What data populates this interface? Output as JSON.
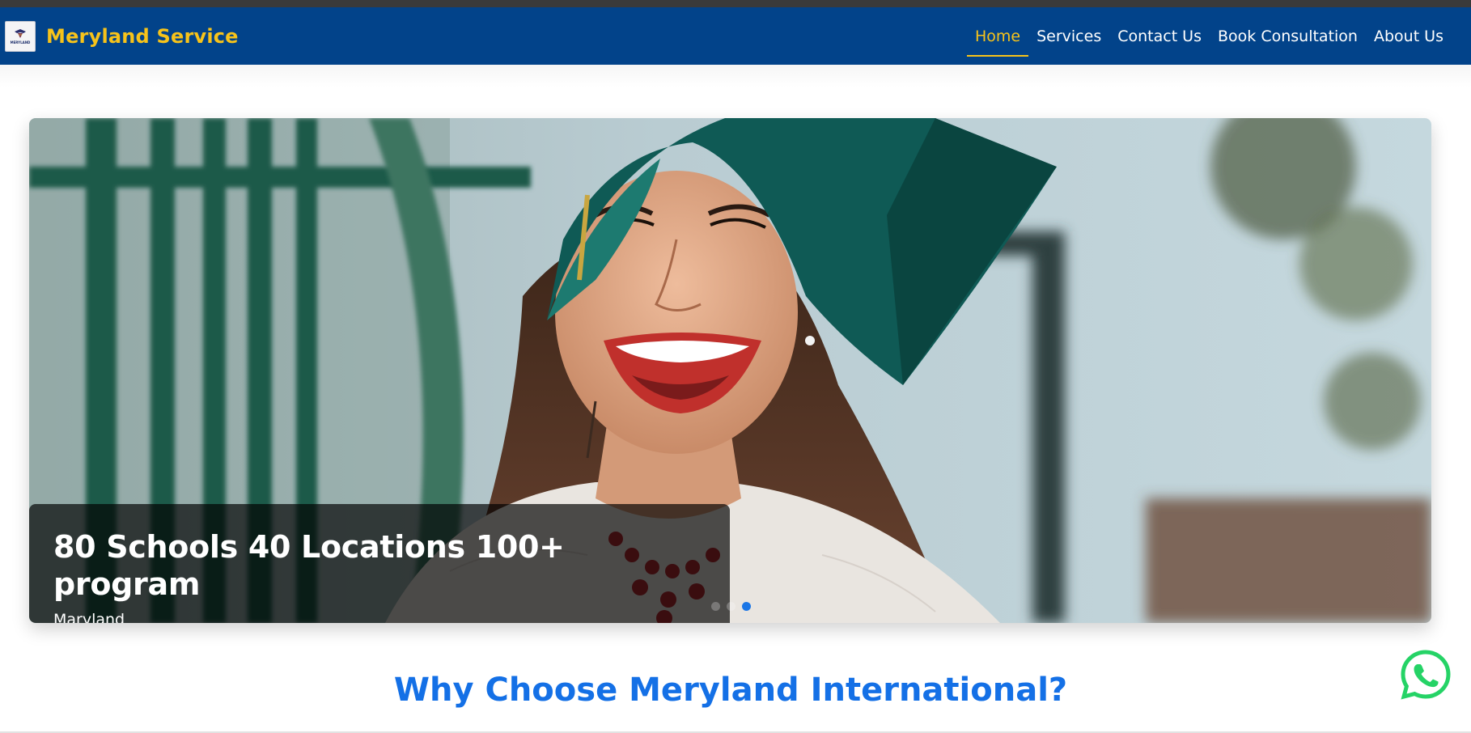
{
  "brand": {
    "name": "Meryland Service",
    "logo_text": "MERYLAND"
  },
  "nav": {
    "items": [
      {
        "label": "Home",
        "active": true
      },
      {
        "label": "Services",
        "active": false
      },
      {
        "label": "Contact Us",
        "active": false
      },
      {
        "label": "Book Consultation",
        "active": false
      },
      {
        "label": "About Us",
        "active": false
      }
    ]
  },
  "hero": {
    "caption_title": "80 Schools 40 Locations 100+ program",
    "caption_subtitle": "Maryland",
    "slide_count": 3,
    "active_slide": 3
  },
  "section": {
    "title": "Why Choose Meryland International?"
  },
  "colors": {
    "navbar": "#02438a",
    "brand_accent": "#f7c31a",
    "section_title": "#1470e6",
    "active_dot": "#1b76e6",
    "whatsapp": "#25d366"
  },
  "icons": {
    "floating_button": "whatsapp-icon"
  }
}
